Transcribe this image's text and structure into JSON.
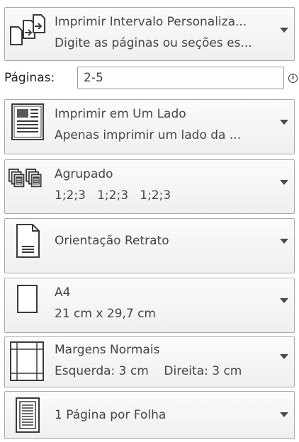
{
  "settings": {
    "range": {
      "title": "Imprimir Intervalo Personaliza...",
      "subtitle": "Digite as páginas ou seções es...",
      "icon": "custom-range-pages-icon"
    },
    "pages": {
      "label": "Páginas:",
      "value": "2-5",
      "info_icon": "info-icon",
      "info_glyph": "i"
    },
    "sides": {
      "title": "Imprimir em Um Lado",
      "subtitle": "Apenas imprimir um lado da ...",
      "icon": "one-sided-print-icon"
    },
    "collate": {
      "title": "Agrupado",
      "subtitle": "1;2;3   1;2;3   1;2;3",
      "icon": "collated-pages-icon"
    },
    "orientation": {
      "title": "Orientação Retrato",
      "icon": "portrait-page-icon"
    },
    "paper_size": {
      "title": "A4",
      "subtitle": "21 cm x 29,7 cm",
      "icon": "paper-size-icon"
    },
    "margins": {
      "title": "Margens Normais",
      "subtitle": "Esquerda: 3 cm    Direita: 3 cm",
      "icon": "normal-margins-icon"
    },
    "pages_per_sheet": {
      "title": "1 Página por Folha",
      "icon": "one-page-per-sheet-icon"
    }
  },
  "colors": {
    "border": "#a9a9a9",
    "text": "#454545",
    "background": "#ffffff"
  }
}
